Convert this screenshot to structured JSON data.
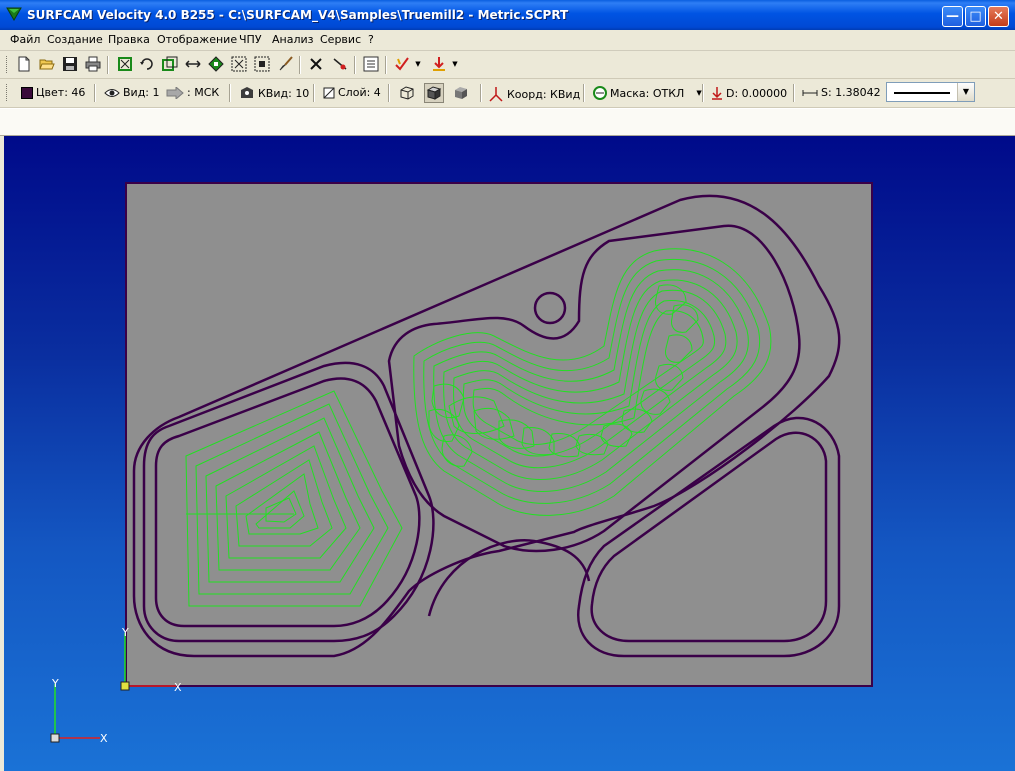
{
  "window": {
    "title": "SURFCAM Velocity 4.0 B255 - C:\\SURFCAM_V4\\Samples\\Truemill2 - Metric.SCPRT",
    "controls": [
      "minimize",
      "maximize",
      "close"
    ]
  },
  "menu": {
    "items": [
      "Файл",
      "Создание",
      "Правка",
      "Отображение",
      "ЧПУ",
      "Анализ",
      "Сервис",
      "?"
    ]
  },
  "toolbar": {
    "icons": [
      "new-file-icon",
      "open-folder-icon",
      "save-icon",
      "print-icon",
      "zoom-all-icon",
      "rotate-icon",
      "zoom-window-icon",
      "pan-icon",
      "fit-icon",
      "select-all-icon",
      "grid-icon",
      "brush-icon",
      "delete-icon",
      "trim-icon",
      "calculator-icon",
      "check-tool-icon",
      "download-icon"
    ]
  },
  "status": {
    "color": "Цвет: 46",
    "view": "Вид: 1",
    "cs": ": МСК",
    "cview": "КВид: 10",
    "layer": "Слой: 4",
    "coord": "Коорд: КВид",
    "mask": "Маска: ОТКЛ",
    "depth": "D: 0.00000",
    "step": "S: 1.38042",
    "color_swatch": "#3a0a3a"
  },
  "viewport": {
    "axis_x": "X",
    "axis_y": "Y",
    "colors": {
      "part_fill": "#8f8f8f",
      "contour": "#3a0048",
      "toolpath": "#22e022"
    }
  }
}
